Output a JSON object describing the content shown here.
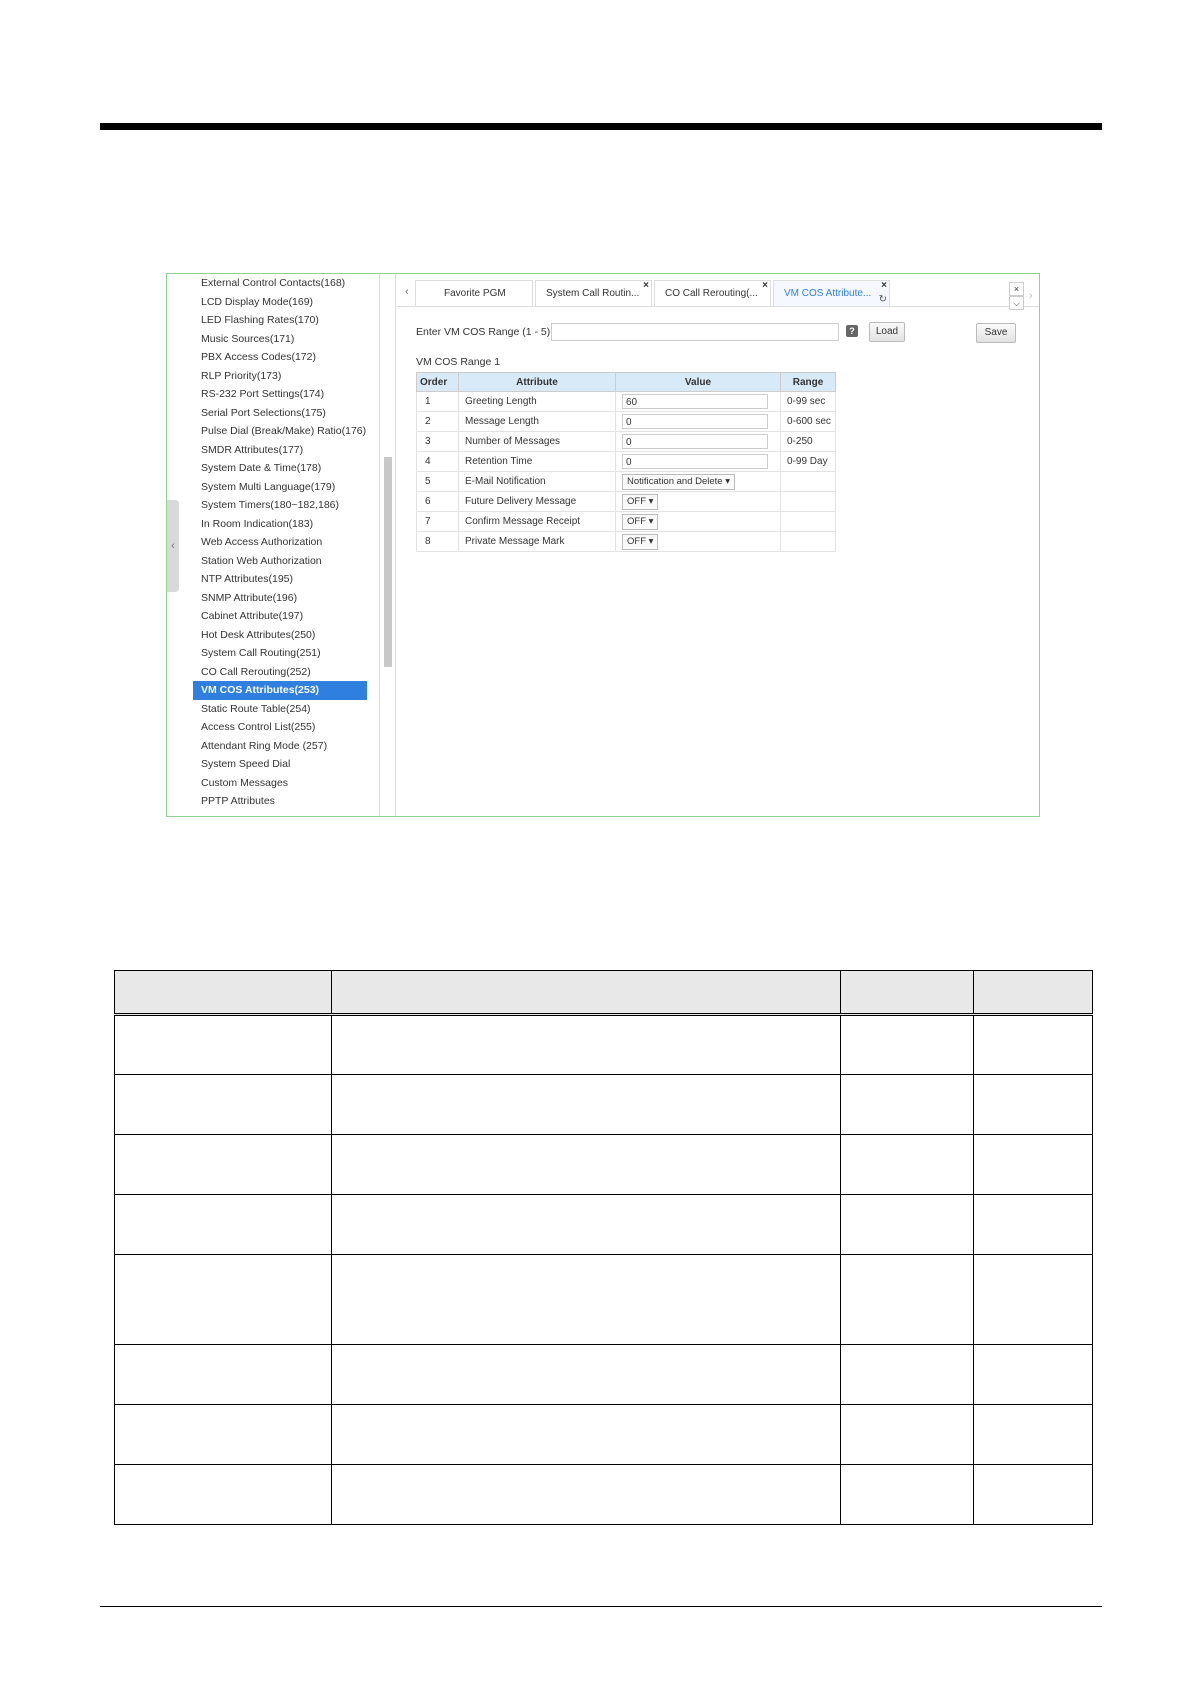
{
  "sidebar": {
    "items": [
      "External Control Contacts(168)",
      "LCD Display Mode(169)",
      "LED Flashing Rates(170)",
      "Music Sources(171)",
      "PBX Access Codes(172)",
      "RLP Priority(173)",
      "RS-232 Port Settings(174)",
      "Serial Port Selections(175)",
      "Pulse Dial (Break/Make) Ratio(176)",
      "SMDR Attributes(177)",
      "System Date & Time(178)",
      "System Multi Language(179)",
      "System Timers(180~182,186)",
      "In Room Indication(183)",
      "Web Access Authorization",
      "Station Web Authorization",
      "NTP Attributes(195)",
      "SNMP Attribute(196)",
      "Cabinet Attribute(197)",
      "Hot Desk Attributes(250)",
      "System Call Routing(251)",
      "CO Call Rerouting(252)",
      "VM COS Attributes(253)",
      "Static Route Table(254)",
      "Access Control List(255)",
      "Attendant Ring Mode (257)",
      "System Speed Dial",
      "Custom Messages",
      "PPTP Attributes"
    ],
    "active": "VM COS Attributes(253)",
    "collapse_glyph": "‹"
  },
  "tabs": [
    {
      "label": "Favorite PGM"
    },
    {
      "label": "System Call Routin..."
    },
    {
      "label": "CO Call Rerouting(..."
    },
    {
      "label": "VM COS Attribute..."
    }
  ],
  "glyphs": {
    "close": "×",
    "refresh": "↻",
    "prev": "‹",
    "next": "›",
    "dropdown": "⌵",
    "help": "?"
  },
  "form": {
    "range_label": "Enter VM COS Range (1 - 5) :",
    "load_label": "Load",
    "save_label": "Save",
    "range_title": "VM COS Range 1"
  },
  "table": {
    "headers": [
      "Order",
      "Attribute",
      "Value",
      "Range"
    ],
    "rows": [
      {
        "order": "1",
        "attribute": "Greeting Length",
        "value": "60",
        "range": "0-99 sec"
      },
      {
        "order": "2",
        "attribute": "Message Length",
        "value": "0",
        "range": "0-600 sec"
      },
      {
        "order": "3",
        "attribute": "Number of Messages",
        "value": "0",
        "range": "0-250"
      },
      {
        "order": "4",
        "attribute": "Retention Time",
        "value": "0",
        "range": "0-99 Day"
      },
      {
        "order": "5",
        "attribute": "E-Mail Notification",
        "value": "Notification and Delete ▾",
        "range": ""
      },
      {
        "order": "6",
        "attribute": "Future Delivery Message",
        "value": "OFF ▾",
        "range": ""
      },
      {
        "order": "7",
        "attribute": "Confirm Message Receipt",
        "value": "OFF ▾",
        "range": ""
      },
      {
        "order": "8",
        "attribute": "Private Message Mark",
        "value": "OFF ▾",
        "range": ""
      }
    ]
  },
  "colors": {
    "accent": "#2f7fe0",
    "header_bg": "#d8eaf8",
    "frame": "#8fd18f"
  }
}
